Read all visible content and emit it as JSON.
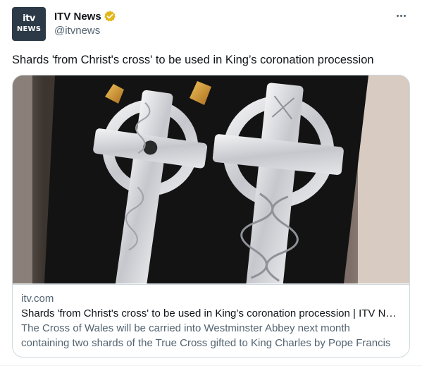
{
  "author": {
    "avatar_logo_top": "itv",
    "avatar_logo_bottom": "NEWS",
    "display_name": "ITV News",
    "handle": "@itvnews",
    "verified_badge_color": "#e2b719"
  },
  "tweet": {
    "text": "Shards 'from Christ's cross' to be used in King’s coronation procession"
  },
  "card": {
    "image_description_icon": "cross-of-wales-image",
    "domain": "itv.com",
    "title": "Shards 'from Christ's cross' to be used in King’s coronation procession | ITV News",
    "description_line1": "The Cross of Wales will be carried into Westminster Abbey next month",
    "description_line2": "containing two shards of the True Cross gifted to King Charles by Pope Francis"
  },
  "colors": {
    "text_primary": "#0f1419",
    "text_secondary": "#536471",
    "border": "#cfd9de",
    "avatar_bg": "#2b3a46"
  },
  "icons": {
    "more": "more-options-icon",
    "verified": "verified-badge-icon"
  }
}
